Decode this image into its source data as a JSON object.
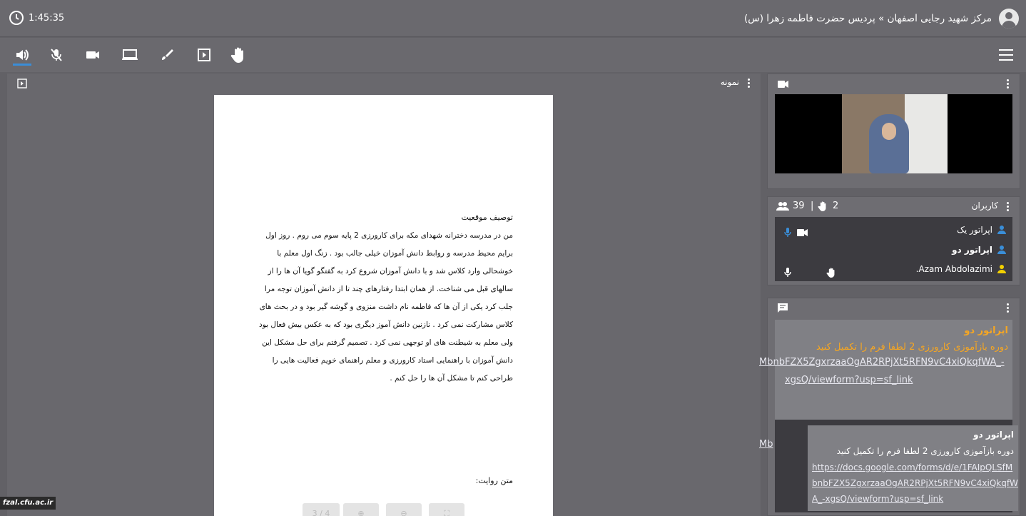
{
  "header": {
    "timer": "1:45:35",
    "title": "مرکز شهید رجایی اصفهان » پردیس حضرت فاطمه زهرا (س)"
  },
  "toolbar": {
    "icons": [
      "speaker-icon",
      "mic-muted-icon",
      "camera-icon",
      "screen-share-icon",
      "brush-icon",
      "play-media-icon",
      "raise-hand-icon",
      "menu-icon"
    ]
  },
  "presentation": {
    "panel_title": "نمونه",
    "heading": "توصیف موقعیت",
    "lines": [
      "من در مدرسه دخترانه شهدای مکه برای کارورزی 2 پایه سوم می روم . روز اول",
      "برایم محیط مدرسه و روابط دانش آموزان خیلی جالب بود . زنگ اول معلم با",
      "خوشحالی وارد کلاس شد و با دانش آموزان شروع کرد به گفتگو گویا آن ها را از",
      "سالهای قبل می شناخت. از همان ابتدا رفتارهای چند تا از دانش آموزان توجه مرا",
      "جلب کرد یکی از آن ها که فاطمه نام داشت منزوی و گوشه گیر بود و در بحث های",
      "کلاس مشارکت نمی کرد . نازنین دانش آموز دیگری بود که به عکس بیش فعال بود",
      "ولی معلم به شیطنت های او توجهی نمی کرد . تصمیم گرفتم برای حل مشکل این",
      "دانش آموزان با راهنمایی استاد کارورزی و معلم راهنمای خویم فعالیت هایی را",
      "طراحی کنم تا مشکل آن ها را حل کنم ."
    ],
    "footer_label": "متن روایت:",
    "page_indicator": "3 / 4"
  },
  "users": {
    "title": "کاربران",
    "count": "39",
    "hands": "2",
    "list": [
      {
        "name": "اپراتور یک",
        "bold": false
      },
      {
        "name": "اپراتور دو",
        "bold": true
      },
      {
        "name": "Azam Abdolazimi.",
        "bold": false
      }
    ]
  },
  "chat": {
    "sender": "اپراتور دو",
    "message": "دوره بازآموزی کارورزی 2 لطفا فرم را تکمیل کنید",
    "link_part1": "MbnbFZX5ZgxrzaaOgAR2RPjXt5RFN9vC4xiQkqfWA_-",
    "link_part2": "xgsQ/viewform?usp=sf_link",
    "overflow_fragment": "Mb",
    "embed_sender": "اپراتور دو",
    "embed_message": "دوره بازآموزی کارورزی 2 لطفا فرم را تکمیل کنید",
    "embed_link_1": "https://docs.google.com/forms/d/e/1FAIpQLSfM",
    "embed_link_2": "bnbFZX5ZgxrzaaOgAR2RPjXt5RFN9vC4xiQkqfW",
    "embed_link_3": "A_-xgsQ/viewform?usp=sf_link"
  },
  "watermark": "fzal.cfu.ac.ir",
  "colors": {
    "accent": "#3a8ed8",
    "chat_sender": "#f5a623",
    "user_icon": "#3a8ed8",
    "guest_icon": "#f2d000"
  }
}
